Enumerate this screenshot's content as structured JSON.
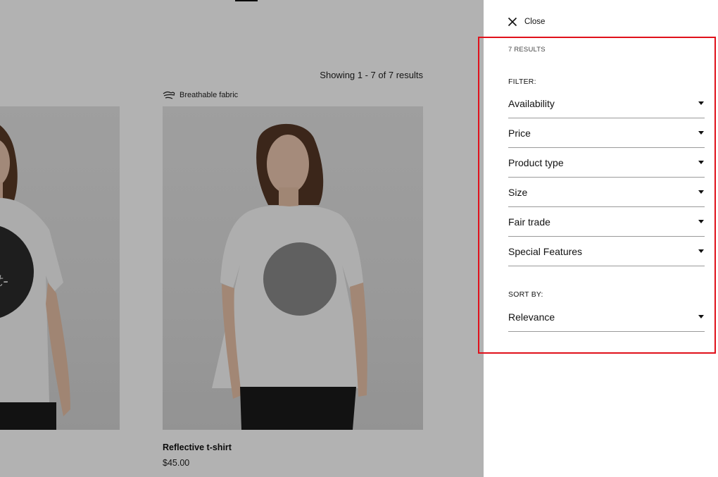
{
  "results": {
    "showing_text": "Showing 1 - 7 of 7 results"
  },
  "products": [
    {
      "name": "",
      "price": "",
      "print_text": "uis Pirat- ay"
    },
    {
      "feature_tag": "Breathable fabric",
      "feature_icon": "breathable-fabric-icon",
      "name": "Reflective t-shirt",
      "price": "$45.00"
    }
  ],
  "drawer": {
    "close_label": "Close",
    "results_count": "7 RESULTS",
    "filter_heading": "FILTER:",
    "filters": [
      {
        "label": "Availability"
      },
      {
        "label": "Price"
      },
      {
        "label": "Product type"
      },
      {
        "label": "Size"
      },
      {
        "label": "Fair trade"
      },
      {
        "label": "Special Features"
      }
    ],
    "sort_heading": "SORT BY:",
    "sort_value": "Relevance"
  },
  "colors": {
    "highlight_border": "#e0111b",
    "overlay": "rgba(0,0,0,0.3)",
    "divider": "#9a9a9a"
  }
}
